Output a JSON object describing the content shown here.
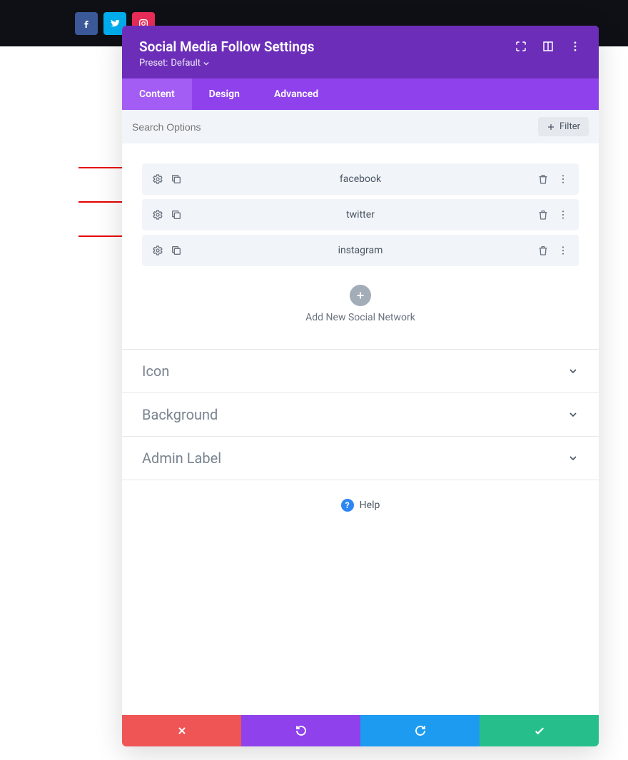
{
  "topSocial": [
    "facebook",
    "twitter",
    "instagram"
  ],
  "modal": {
    "title": "Social Media Follow Settings",
    "presetPrefix": "Preset:",
    "presetValue": "Default"
  },
  "tabs": [
    "Content",
    "Design",
    "Advanced"
  ],
  "search": {
    "placeholder": "Search Options"
  },
  "filterLabel": "Filter",
  "items": [
    {
      "label": "facebook"
    },
    {
      "label": "twitter"
    },
    {
      "label": "instagram"
    }
  ],
  "addLabel": "Add New Social Network",
  "accordions": [
    "Icon",
    "Background",
    "Admin Label"
  ],
  "helpLabel": "Help"
}
